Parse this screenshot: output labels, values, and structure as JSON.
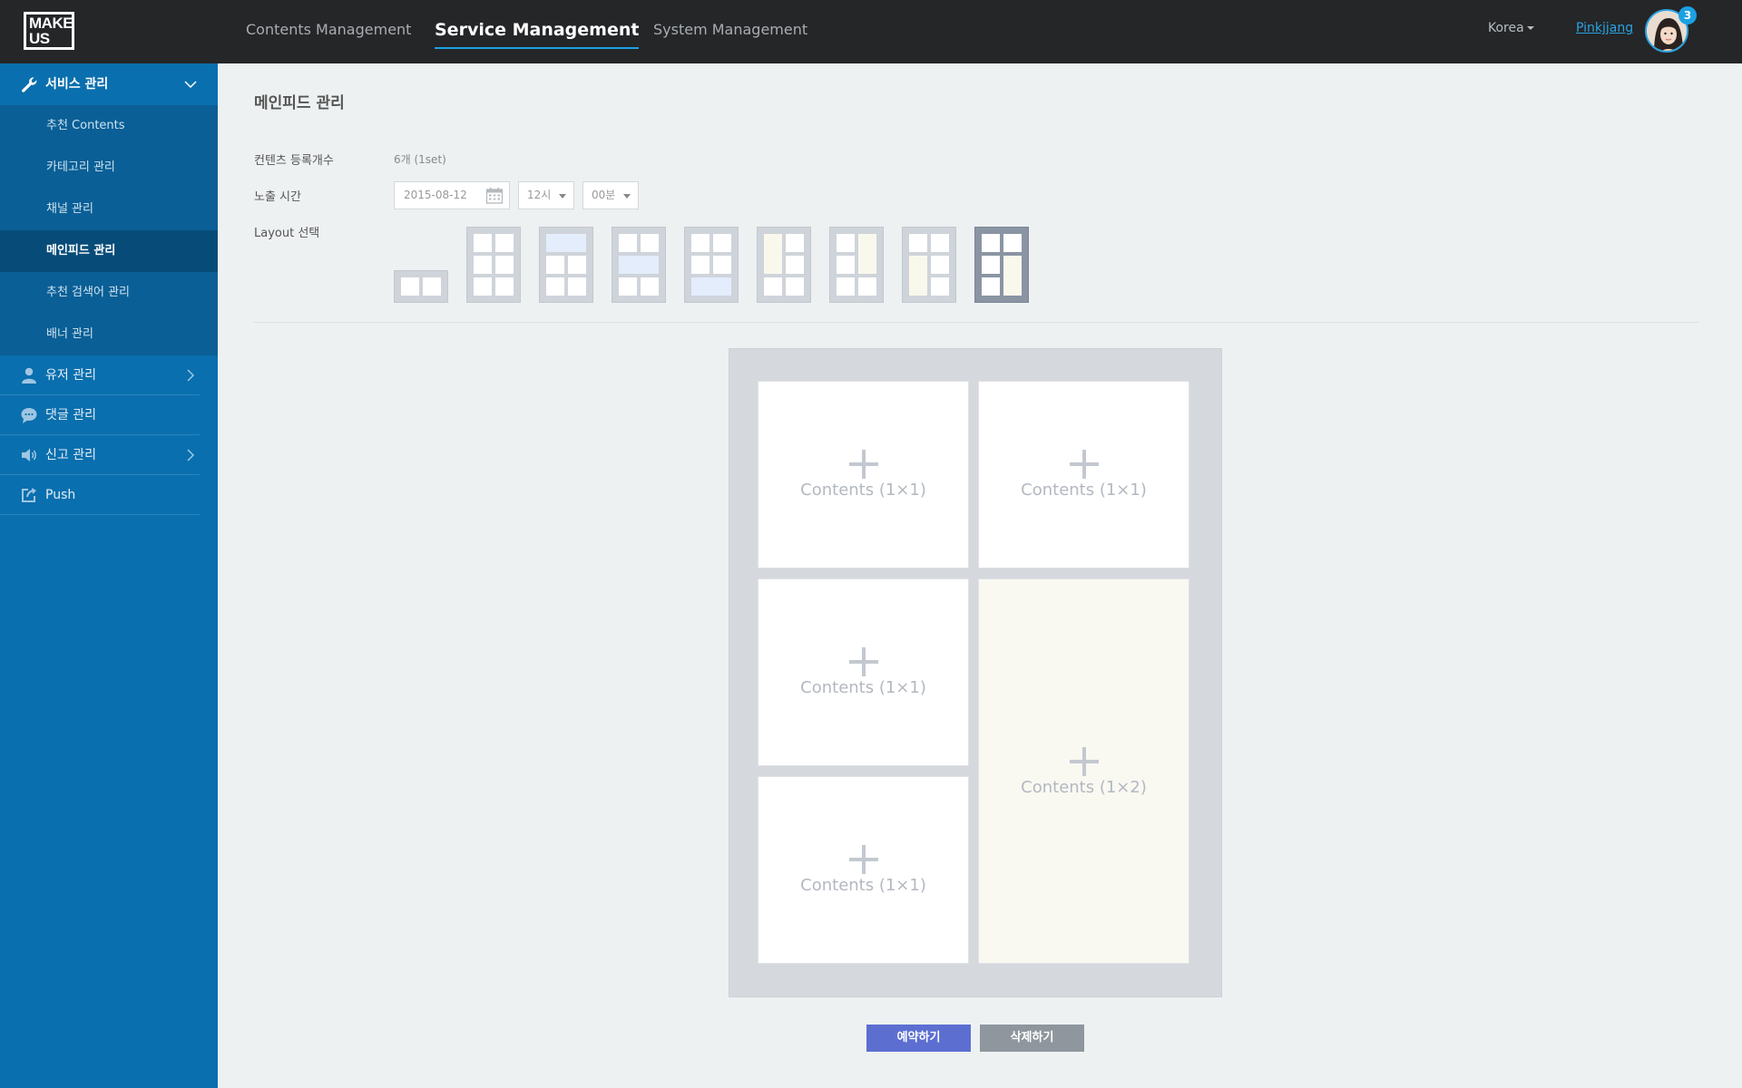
{
  "header": {
    "logo_line1": "MAKE",
    "logo_line2": "US",
    "nav": [
      {
        "label": "Contents Management",
        "active": false
      },
      {
        "label": "Service Management",
        "active": true
      },
      {
        "label": "System Management",
        "active": false
      }
    ],
    "country": "Korea",
    "username": "Pinkjjang",
    "notification_count": "3"
  },
  "sidebar": {
    "service_group": {
      "label": "서비스 관리",
      "icon": "wrench-icon",
      "expanded": true,
      "items": [
        {
          "label": "추천 Contents",
          "active": false
        },
        {
          "label": "카테고리 관리",
          "active": false
        },
        {
          "label": "채널 관리",
          "active": false
        },
        {
          "label": "메인피드 관리",
          "active": true
        },
        {
          "label": "추천 검색어 관리",
          "active": false
        },
        {
          "label": "배너 관리",
          "active": false
        }
      ]
    },
    "groups": [
      {
        "label": "유저 관리",
        "icon": "user-icon",
        "has_children": true
      },
      {
        "label": "댓글 관리",
        "icon": "comment-icon",
        "has_children": false
      },
      {
        "label": "신고 관리",
        "icon": "megaphone-icon",
        "has_children": true
      },
      {
        "label": "Push",
        "icon": "share-icon",
        "has_children": false
      }
    ]
  },
  "main": {
    "title": "메인피드 관리",
    "count_label": "컨텐츠 등록개수",
    "count_value": "6개 (1set)",
    "time_label": "노출 시간",
    "date_value": "2015-08-12",
    "hour_value": "12시",
    "minute_value": "00분",
    "layout_label": "Layout 선택",
    "selected_layout_index": 8,
    "slots": [
      {
        "label": "Contents (1×1)"
      },
      {
        "label": "Contents (1×1)"
      },
      {
        "label": "Contents (1×1)"
      },
      {
        "label": "Contents (1×2)"
      },
      {
        "label": "Contents (1×1)"
      }
    ],
    "reserve_button": "예약하기",
    "delete_button": "삭제하기"
  },
  "colors": {
    "header_bg": "#242628",
    "sidebar_bg": "#0a6fae",
    "accent": "#1ba1e2",
    "primary_button": "#5c6fd1",
    "secondary_button": "#8f969d"
  }
}
